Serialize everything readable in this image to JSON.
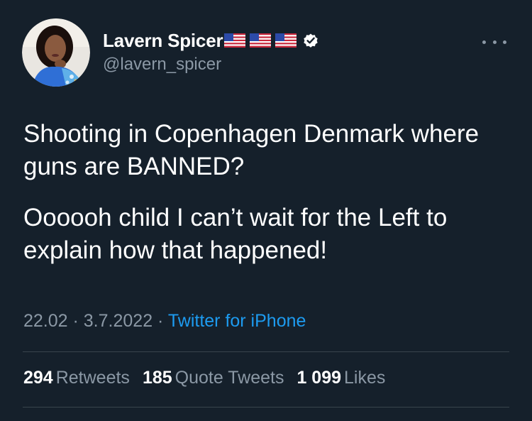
{
  "author": {
    "display_name": "Lavern Spicer",
    "flag_icons": [
      "us-flag-icon",
      "us-flag-icon",
      "us-flag-icon"
    ],
    "verified_icon": "verified-badge-icon",
    "handle": "@lavern_spicer",
    "avatar_icon": "profile-photo"
  },
  "menu": {
    "icon": "more-options-icon"
  },
  "tweet": {
    "paragraphs": [
      "Shooting in Copenhagen Denmark where guns are BANNED?",
      "Oooooh child I can’t wait for the Left to explain how that happened!"
    ]
  },
  "meta": {
    "time": "22.02",
    "separator": " · ",
    "date": "3.7.2022",
    "source": "Twitter for iPhone"
  },
  "stats": {
    "retweets_count": "294",
    "retweets_label": "Retweets",
    "quotes_count": "185",
    "quotes_label": "Quote Tweets",
    "likes_count": "1 099",
    "likes_label": "Likes"
  },
  "colors": {
    "background": "#15202b",
    "text": "#ffffff",
    "secondary": "#8b98a5",
    "link": "#1d9bf0",
    "divider": "#38444d"
  }
}
